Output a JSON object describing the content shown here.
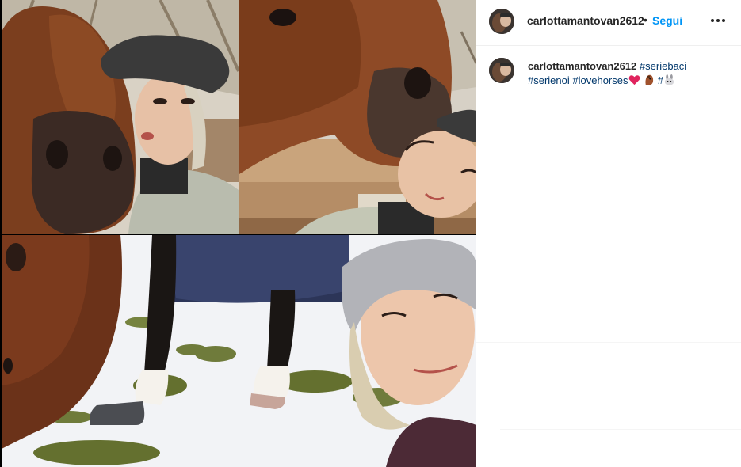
{
  "post": {
    "username": "carlottamantovan2612",
    "separator": "•",
    "follow_label": "Segui",
    "more_icon": "more-horizontal-icon",
    "caption": {
      "username": "carlottamantovan2612",
      "hashtags": [
        "#seriebaci",
        "#serienoi",
        "#lovehorses",
        "#"
      ],
      "emojis": [
        "red-heart-emoji",
        "horse-face-emoji",
        "rabbit-emoji"
      ]
    }
  },
  "media": {
    "tiles": [
      {
        "name": "photo-horse-and-woman-in-cap"
      },
      {
        "name": "photo-horse-nuzzling-woman"
      },
      {
        "name": "photo-horse-in-snow-selfie"
      }
    ]
  },
  "colors": {
    "follow_link": "#0095f6",
    "hashtag": "#00376b",
    "text": "#262626"
  }
}
